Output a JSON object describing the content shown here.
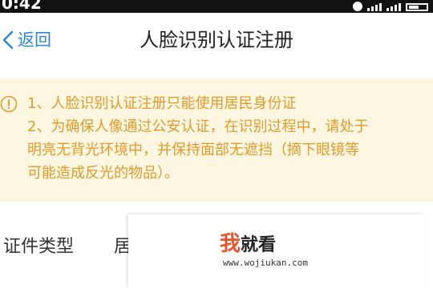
{
  "status_bar": {
    "time": "0:42"
  },
  "nav": {
    "back_label": "返回",
    "title": "人脸识别认证注册"
  },
  "notice": {
    "lines": [
      "1、人脸识别认证注册只能使用居民身份证",
      "2、为确保人像通过公安认证，在识别过程中，请处于",
      "明亮无背光环境中，并保持面部无遮挡（摘下眼镜等",
      "可能造成反光的物品）。"
    ]
  },
  "form": {
    "id_type_label": "证件类型",
    "id_type_value": "居"
  },
  "watermark": {
    "brand_accent": "我",
    "brand_rest": "就看",
    "url": "www.wojiukan.com"
  },
  "colors": {
    "accent": "#2e86de",
    "notice_text": "#e29a2d",
    "notice_bg": "#fdf6e0",
    "watermark_accent": "#e8542c"
  }
}
